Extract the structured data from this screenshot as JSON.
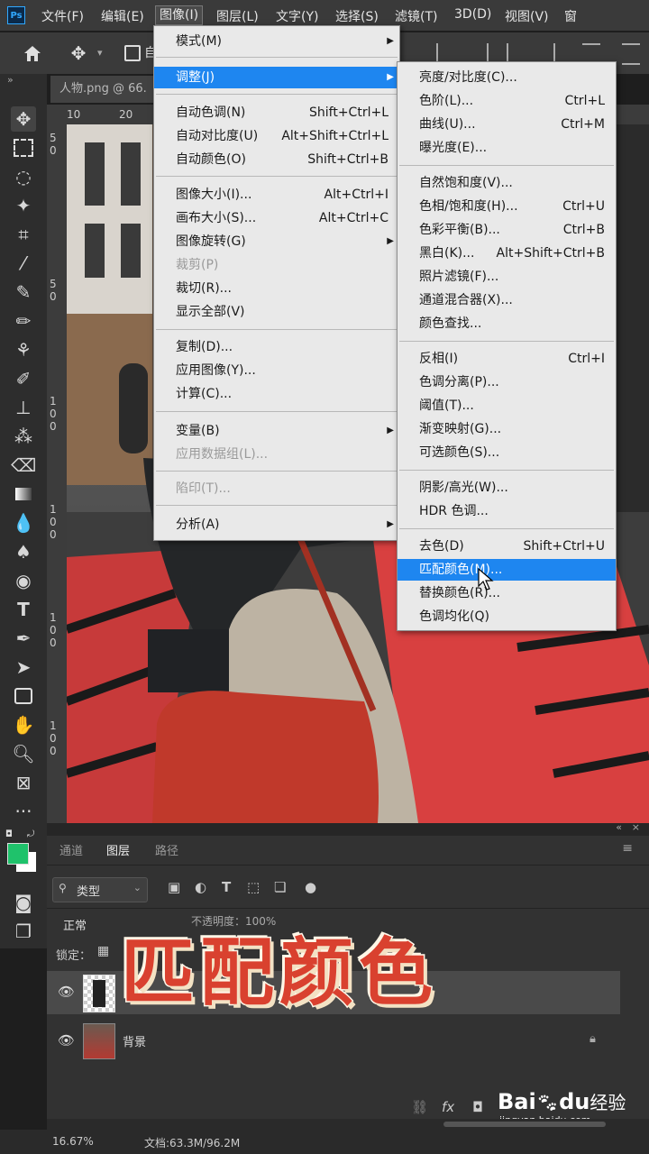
{
  "menubar": {
    "logo": "Ps",
    "items": [
      "文件(F)",
      "编辑(E)",
      "图像(I)",
      "图层(L)",
      "文字(Y)",
      "选择(S)",
      "滤镜(T)",
      "3D(D)",
      "视图(V)",
      "窗"
    ]
  },
  "document": {
    "tab_title": "人物.png @ 66."
  },
  "rulers": {
    "top": [
      "10",
      "20"
    ],
    "left": [
      "5\n0",
      "5\n0",
      "1\n0\n0",
      "1\n0\n0",
      "1\n0\n0",
      "1\n0\n0"
    ]
  },
  "image_menu": {
    "items": [
      {
        "label": "模式(M)",
        "shortcut": "",
        "submenu": true
      },
      {
        "label": "调整(J)",
        "shortcut": "",
        "submenu": true,
        "highlighted": true
      },
      {
        "label": "自动色调(N)",
        "shortcut": "Shift+Ctrl+L"
      },
      {
        "label": "自动对比度(U)",
        "shortcut": "Alt+Shift+Ctrl+L"
      },
      {
        "label": "自动颜色(O)",
        "shortcut": "Shift+Ctrl+B"
      },
      {
        "label": "图像大小(I)...",
        "shortcut": "Alt+Ctrl+I"
      },
      {
        "label": "画布大小(S)...",
        "shortcut": "Alt+Ctrl+C"
      },
      {
        "label": "图像旋转(G)",
        "shortcut": "",
        "submenu": true
      },
      {
        "label": "裁剪(P)",
        "shortcut": "",
        "disabled": true
      },
      {
        "label": "裁切(R)...",
        "shortcut": ""
      },
      {
        "label": "显示全部(V)",
        "shortcut": ""
      },
      {
        "label": "复制(D)...",
        "shortcut": ""
      },
      {
        "label": "应用图像(Y)...",
        "shortcut": ""
      },
      {
        "label": "计算(C)...",
        "shortcut": ""
      },
      {
        "label": "变量(B)",
        "shortcut": "",
        "submenu": true
      },
      {
        "label": "应用数据组(L)...",
        "shortcut": "",
        "disabled": true
      },
      {
        "label": "陷印(T)...",
        "shortcut": "",
        "disabled": true
      },
      {
        "label": "分析(A)",
        "shortcut": "",
        "submenu": true
      }
    ]
  },
  "adjust_menu": {
    "items": [
      {
        "label": "亮度/对比度(C)...",
        "shortcut": ""
      },
      {
        "label": "色阶(L)...",
        "shortcut": "Ctrl+L"
      },
      {
        "label": "曲线(U)...",
        "shortcut": "Ctrl+M"
      },
      {
        "label": "曝光度(E)...",
        "shortcut": ""
      },
      {
        "label": "自然饱和度(V)...",
        "shortcut": ""
      },
      {
        "label": "色相/饱和度(H)...",
        "shortcut": "Ctrl+U"
      },
      {
        "label": "色彩平衡(B)...",
        "shortcut": "Ctrl+B"
      },
      {
        "label": "黑白(K)...",
        "shortcut": "Alt+Shift+Ctrl+B"
      },
      {
        "label": "照片滤镜(F)...",
        "shortcut": ""
      },
      {
        "label": "通道混合器(X)...",
        "shortcut": ""
      },
      {
        "label": "颜色查找...",
        "shortcut": ""
      },
      {
        "label": "反相(I)",
        "shortcut": "Ctrl+I"
      },
      {
        "label": "色调分离(P)...",
        "shortcut": ""
      },
      {
        "label": "阈值(T)...",
        "shortcut": ""
      },
      {
        "label": "渐变映射(G)...",
        "shortcut": ""
      },
      {
        "label": "可选颜色(S)...",
        "shortcut": ""
      },
      {
        "label": "阴影/高光(W)...",
        "shortcut": ""
      },
      {
        "label": "HDR 色调...",
        "shortcut": ""
      },
      {
        "label": "去色(D)",
        "shortcut": "Shift+Ctrl+U"
      },
      {
        "label": "匹配颜色(M)...",
        "shortcut": "",
        "highlighted": true
      },
      {
        "label": "替换颜色(R)...",
        "shortcut": ""
      },
      {
        "label": "色调均化(Q)",
        "shortcut": ""
      }
    ]
  },
  "layers_panel": {
    "tabs": [
      "通道",
      "图层",
      "路径"
    ],
    "active_tab": "图层",
    "filter_label": "类型",
    "blend_mode": "正常",
    "opacity_label": "不透明度：100%",
    "lock_label": "锁定：",
    "layers": [
      {
        "name": "",
        "visible": true,
        "selected": true
      },
      {
        "name": "背景",
        "visible": true,
        "locked": true
      }
    ]
  },
  "overlay_title": "匹配颜色",
  "watermark": {
    "brand": "Bai",
    "brand2": "du",
    "suffix": "经验",
    "url": "jingyan.baidu.com"
  },
  "statusbar": {
    "zoom": "16.67%",
    "doc_info": "文档:63.3M/96.2M"
  },
  "colors": {
    "foreground": "#1fc26b",
    "background": "#ffffff",
    "highlight": "#1e86f0"
  }
}
